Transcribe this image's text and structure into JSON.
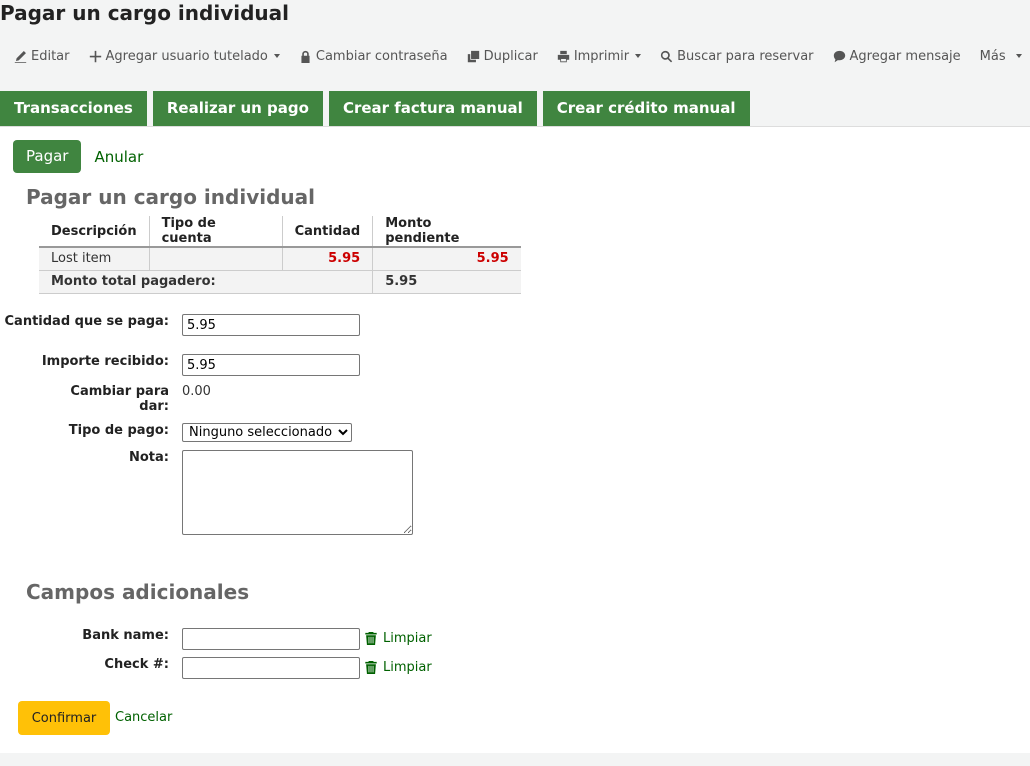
{
  "header": {
    "title": "Pagar un cargo individual"
  },
  "toolbar": {
    "edit": "Editar",
    "add_guarantee": "Agregar usuario tutelado",
    "change_password": "Cambiar contraseña",
    "duplicate": "Duplicar",
    "print": "Imprimir",
    "search_hold": "Buscar para reservar",
    "add_message": "Agregar mensaje",
    "more": "Más"
  },
  "tabs": [
    "Transacciones",
    "Realizar un pago",
    "Crear factura manual",
    "Crear crédito manual"
  ],
  "subnav": {
    "pay": "Pagar",
    "void": "Anular"
  },
  "section_title": "Pagar un cargo individual",
  "fees_table": {
    "headers": [
      "Descripción",
      "Tipo de cuenta",
      "Cantidad",
      "Monto pendiente"
    ],
    "rows": [
      {
        "description": "Lost item",
        "account_type": "",
        "amount": "5.95",
        "outstanding": "5.95"
      }
    ],
    "total_label": "Monto total pagadero:",
    "total_value": "5.95"
  },
  "form": {
    "paid_label": "Cantidad que se paga:",
    "paid_value": "5.95",
    "tendered_label": "Importe recibido:",
    "tendered_value": "5.95",
    "change_label": "Cambiar para dar:",
    "change_value": "0.00",
    "payment_type_label": "Tipo de pago:",
    "payment_type_selected": "Ninguno seleccionado",
    "note_label": "Nota:",
    "note_value": ""
  },
  "additional": {
    "title": "Campos adicionales",
    "bank_label": "Bank name:",
    "bank_value": "",
    "check_label": "Check #:",
    "check_value": "",
    "clear_label": "Limpiar"
  },
  "actions": {
    "confirm": "Confirmar",
    "cancel": "Cancelar"
  },
  "colors": {
    "primary_green": "#408540",
    "link_green": "#006100",
    "confirm_yellow": "#ffc107",
    "amount_red": "#cc0000"
  }
}
